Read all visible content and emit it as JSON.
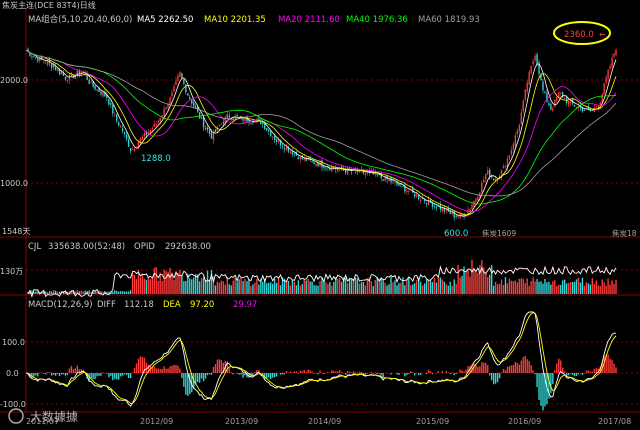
{
  "title": "焦炭主连(DCE 83T4)日线",
  "ma_bar": {
    "label": "MA组合(5,10,20,40,60,0)",
    "items": [
      {
        "text": "MA5 2262.50",
        "color": "#ffffff"
      },
      {
        "text": "MA10 2201.35",
        "color": "#ffff00"
      },
      {
        "text": "MA20 2111.60",
        "color": "#ff00ff"
      },
      {
        "text": "MA40 1976.36",
        "color": "#00ff00"
      },
      {
        "text": "MA60 1819.93",
        "color": "#a0a0a0"
      }
    ]
  },
  "price_panel": {
    "y_labels": [
      "2000.0",
      "1000.0"
    ],
    "y_values": [
      2000,
      1000
    ],
    "ylim": [
      440,
      2560
    ],
    "annotations": {
      "high": "2360.0",
      "low1": "1288.0",
      "low2": "600.0"
    },
    "contract_labels": [
      "焦炭1609",
      "焦炭18"
    ],
    "days_label": "1548天"
  },
  "volume_panel": {
    "label": "CJL",
    "value": "335638.00(52:48)",
    "opid_label": "OPID",
    "opid_value": "292638.00",
    "y_label": "130万"
  },
  "macd_panel": {
    "label": "MACD(12,26,9)",
    "diff_label": "DIFF",
    "diff_value": "112.18",
    "dea_label": "DEA",
    "dea_value": "97.20",
    "macd_value": "29.97",
    "y_labels": [
      "100.0",
      "0.0",
      "-100.0"
    ]
  },
  "x_axis": [
    "2011/07",
    "2012/09",
    "2013/09",
    "2014/09",
    "2015/09",
    "2016/09",
    "2017/08"
  ],
  "watermark": "大数據據",
  "colors": {
    "up": "#ff3b3b",
    "down": "#33d6d6",
    "grid": "#8b0000",
    "text": "#c0c0c0",
    "highlight": "#ffff00"
  },
  "chart_data": {
    "type": "candlestick",
    "x_start": "2011/07",
    "x_end": "2017/08",
    "close_path": [
      [
        "2011/07",
        2330
      ],
      [
        "2011/08",
        2260
      ],
      [
        "2011/10",
        2190
      ],
      [
        "2011/12",
        2040
      ],
      [
        "2012/02",
        2120
      ],
      [
        "2012/03",
        1980
      ],
      [
        "2012/05",
        1850
      ],
      [
        "2012/06",
        1640
      ],
      [
        "2012/07",
        1500
      ],
      [
        "2012/08",
        1300
      ],
      [
        "2012/09",
        1400
      ],
      [
        "2012/11",
        1560
      ],
      [
        "2012/12",
        1700
      ],
      [
        "2013/01",
        1860
      ],
      [
        "2013/02",
        2100
      ],
      [
        "2013/03",
        1880
      ],
      [
        "2013/05",
        1560
      ],
      [
        "2013/06",
        1440
      ],
      [
        "2013/07",
        1560
      ],
      [
        "2013/08",
        1660
      ],
      [
        "2013/10",
        1620
      ],
      [
        "2013/12",
        1600
      ],
      [
        "2014/02",
        1400
      ],
      [
        "2014/05",
        1220
      ],
      [
        "2014/08",
        1140
      ],
      [
        "2014/10",
        1100
      ],
      [
        "2014/12",
        1080
      ],
      [
        "2015/02",
        1050
      ],
      [
        "2015/04",
        990
      ],
      [
        "2015/06",
        900
      ],
      [
        "2015/08",
        800
      ],
      [
        "2015/10",
        720
      ],
      [
        "2015/12",
        630
      ],
      [
        "2016/01",
        620
      ],
      [
        "2016/02",
        720
      ],
      [
        "2016/03",
        860
      ],
      [
        "2016/04",
        1080
      ],
      [
        "2016/05",
        1000
      ],
      [
        "2016/06",
        1100
      ],
      [
        "2016/07",
        1300
      ],
      [
        "2016/08",
        1560
      ],
      [
        "2016/09",
        2000
      ],
      [
        "2016/10",
        2300
      ],
      [
        "2016/11",
        1900
      ],
      [
        "2016/12",
        1720
      ],
      [
        "2017/01",
        1900
      ],
      [
        "2017/02",
        1800
      ],
      [
        "2017/03",
        1760
      ],
      [
        "2017/04",
        1720
      ],
      [
        "2017/05",
        1700
      ],
      [
        "2017/06",
        1800
      ],
      [
        "2017/07",
        2100
      ],
      [
        "2017/08",
        2360
      ]
    ]
  }
}
